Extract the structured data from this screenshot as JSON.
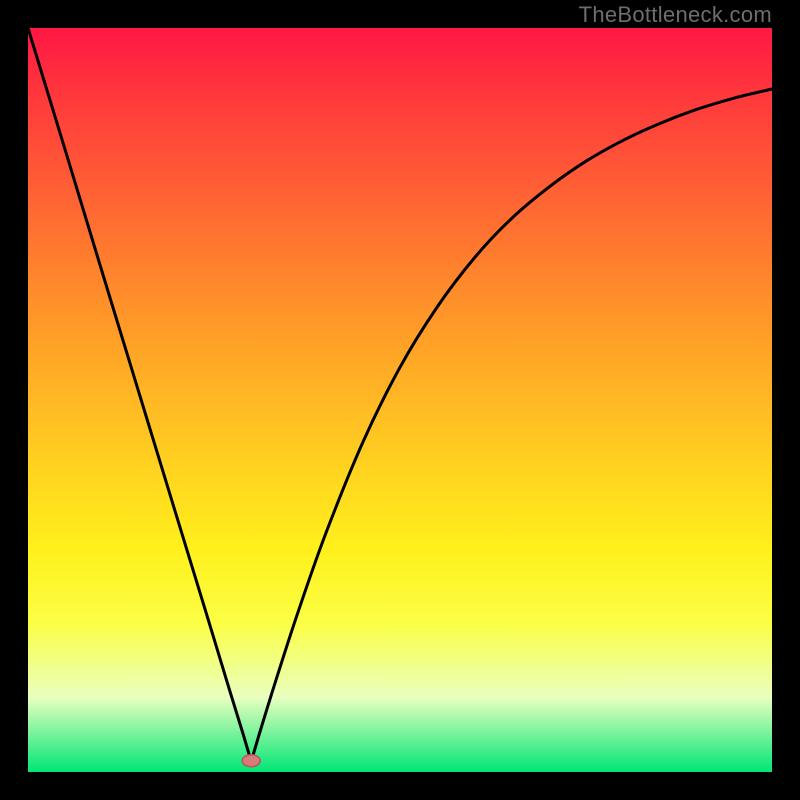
{
  "watermark": "TheBottleneck.com",
  "chart_data": {
    "type": "line",
    "title": "",
    "xlabel": "",
    "ylabel": "",
    "xlim": [
      0,
      1
    ],
    "ylim": [
      0,
      1
    ],
    "series": [
      {
        "name": "curve",
        "x": [
          0.0,
          0.05,
          0.1,
          0.15,
          0.2,
          0.24,
          0.27,
          0.29,
          0.298,
          0.3,
          0.302,
          0.31,
          0.33,
          0.36,
          0.4,
          0.45,
          0.5,
          0.55,
          0.6,
          0.65,
          0.7,
          0.75,
          0.8,
          0.85,
          0.9,
          0.95,
          1.0
        ],
        "values": [
          1.0,
          0.836,
          0.671,
          0.507,
          0.343,
          0.212,
          0.113,
          0.048,
          0.021,
          0.015,
          0.021,
          0.048,
          0.113,
          0.206,
          0.32,
          0.443,
          0.544,
          0.625,
          0.691,
          0.744,
          0.786,
          0.821,
          0.849,
          0.872,
          0.891,
          0.906,
          0.918
        ]
      }
    ],
    "marker": {
      "x": 0.3,
      "y": 0.015
    },
    "colors": {
      "curve": "#000000",
      "marker_fill": "#d97a7a",
      "marker_stroke": "#b35a5a",
      "gradient_top": "#ff1744",
      "gradient_bottom": "#00e676"
    }
  }
}
